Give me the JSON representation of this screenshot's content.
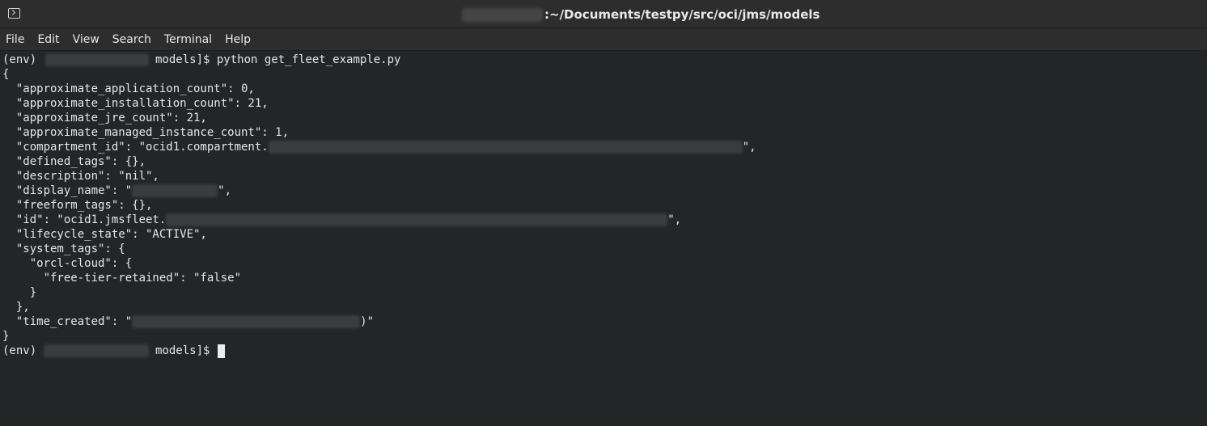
{
  "window": {
    "title": ":~/Documents/testpy/src/oci/jms/models"
  },
  "menu": [
    "File",
    "Edit",
    "View",
    "Search",
    "Terminal",
    "Help"
  ],
  "terminal": {
    "prompt_prefix": "(env) ",
    "prompt_suffix": " models]$ ",
    "command": "python get_fleet_example.py",
    "lines": {
      "open_brace": "{",
      "l1": "  \"approximate_application_count\": 0,",
      "l2": "  \"approximate_installation_count\": 21,",
      "l3": "  \"approximate_jre_count\": 21,",
      "l4": "  \"approximate_managed_instance_count\": 1,",
      "l5_pre": "  \"compartment_id\": \"ocid1.compartment.",
      "l5_post": "\",",
      "l6": "  \"defined_tags\": {},",
      "l7": "  \"description\": \"nil\",",
      "l8_pre": "  \"display_name\": \"",
      "l8_post": "\",",
      "l9": "  \"freeform_tags\": {},",
      "l10_pre": "  \"id\": \"ocid1.jmsfleet.",
      "l10_post": "\",",
      "l11": "  \"lifecycle_state\": \"ACTIVE\",",
      "l12": "  \"system_tags\": {",
      "l13": "    \"orcl-cloud\": {",
      "l14": "      \"free-tier-retained\": \"false\"",
      "l15": "    }",
      "l16": "  },",
      "l17_pre": "  \"time_created\": \"",
      "l17_post": ")\"",
      "close_brace": "}"
    }
  }
}
